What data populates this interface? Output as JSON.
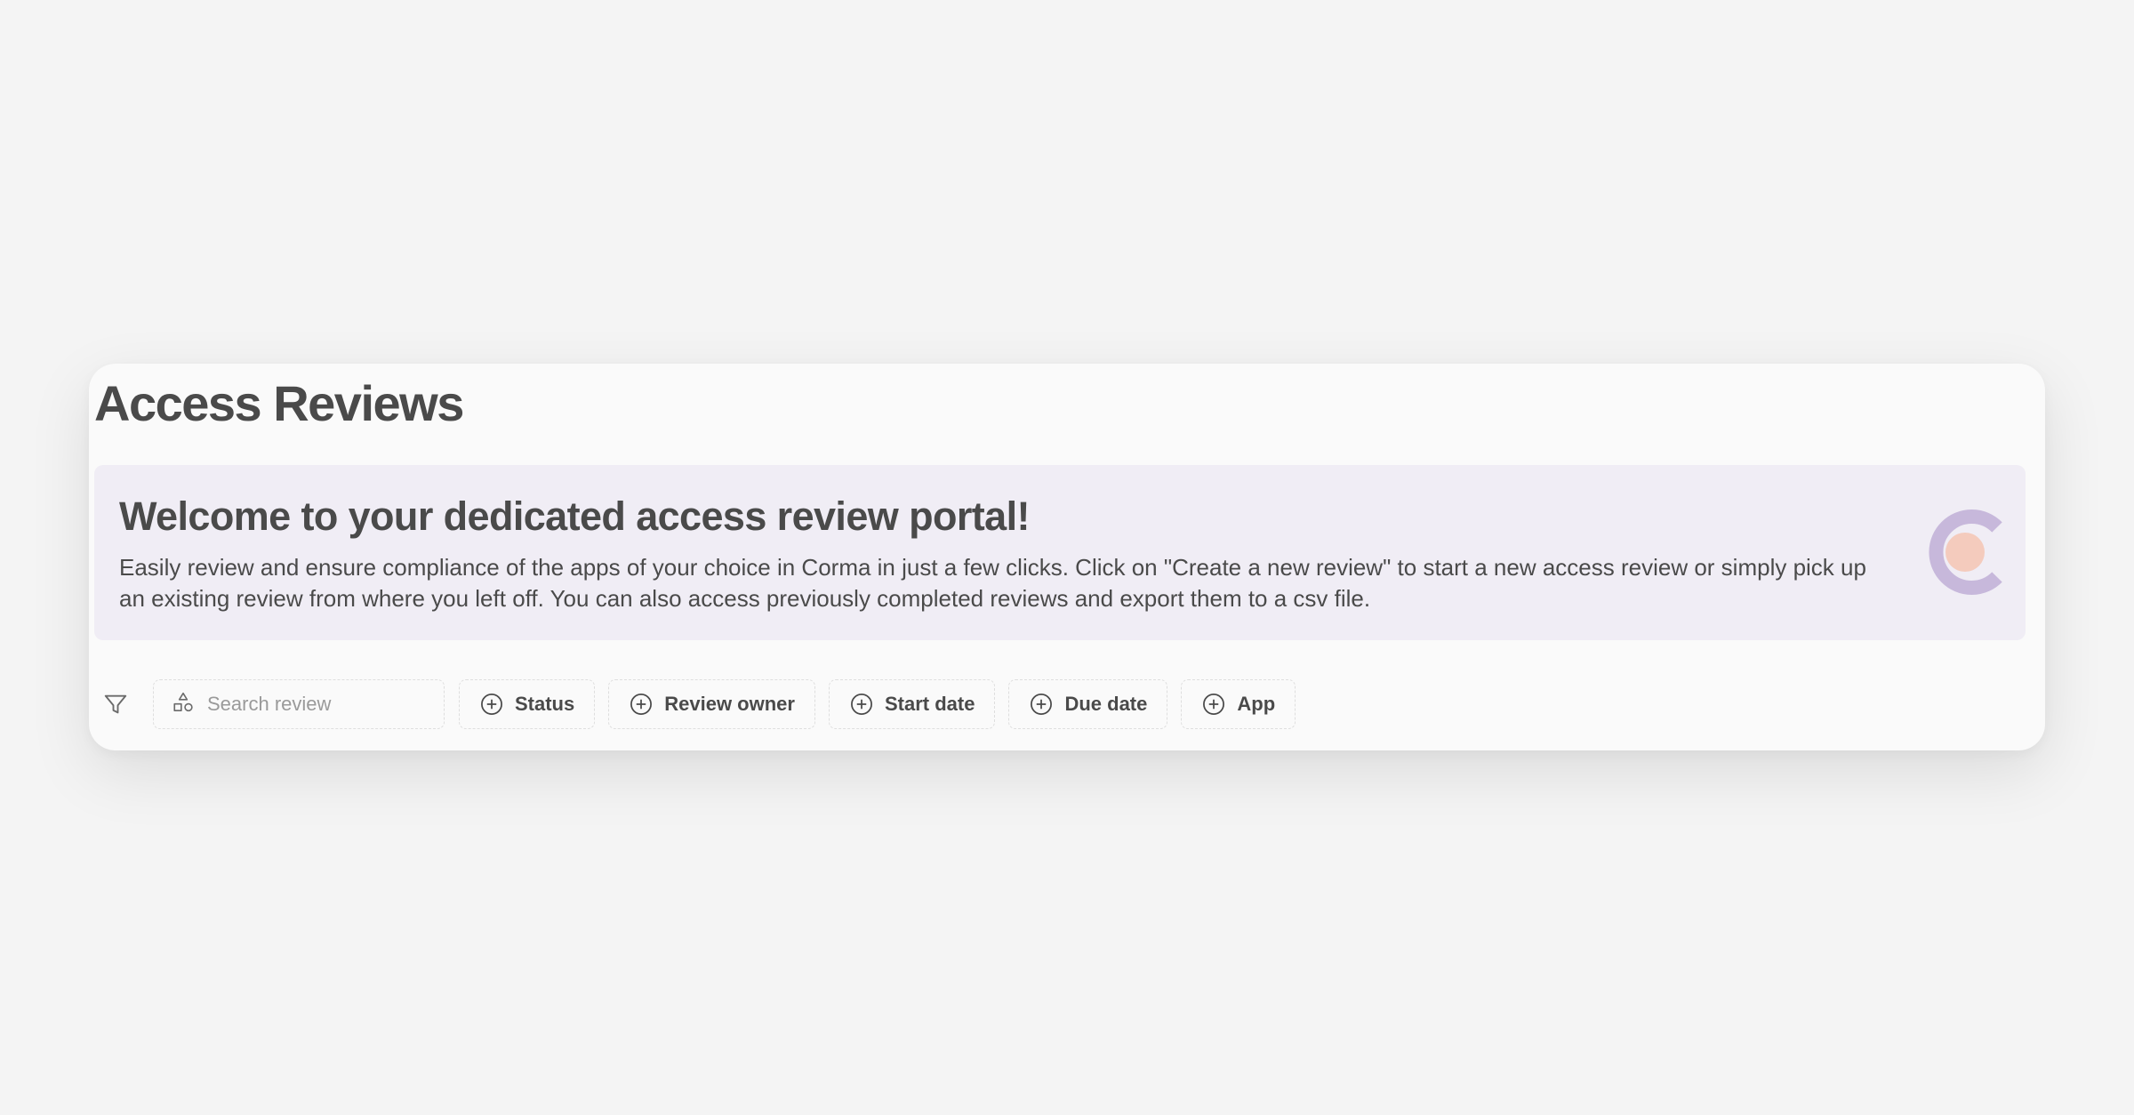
{
  "page": {
    "title": "Access Reviews"
  },
  "banner": {
    "title": "Welcome to your dedicated access review portal!",
    "description": "Easily review and ensure compliance of the apps of your choice in Corma in just a few clicks. Click on \"Create a new review\" to start a new access review or simply pick up an existing review from where you left off. You can also access previously completed reviews and export them to a csv file.",
    "logo_icon": "corma-logo-icon"
  },
  "filters": {
    "filter_icon": "funnel-icon",
    "search": {
      "icon": "shapes-icon",
      "placeholder": "Search review",
      "value": ""
    },
    "chips": [
      {
        "label": "Status",
        "icon": "plus-circle-icon"
      },
      {
        "label": "Review owner",
        "icon": "plus-circle-icon"
      },
      {
        "label": "Start date",
        "icon": "plus-circle-icon"
      },
      {
        "label": "Due date",
        "icon": "plus-circle-icon"
      },
      {
        "label": "App",
        "icon": "plus-circle-icon"
      }
    ]
  },
  "colors": {
    "background": "#f4f4f4",
    "card": "#fafafa",
    "banner": "#f0edf5",
    "text": "#4a4a4a",
    "placeholder": "#9a9a9a",
    "logo_purple": "#c7b8db",
    "logo_peach": "#f4cbbd"
  }
}
